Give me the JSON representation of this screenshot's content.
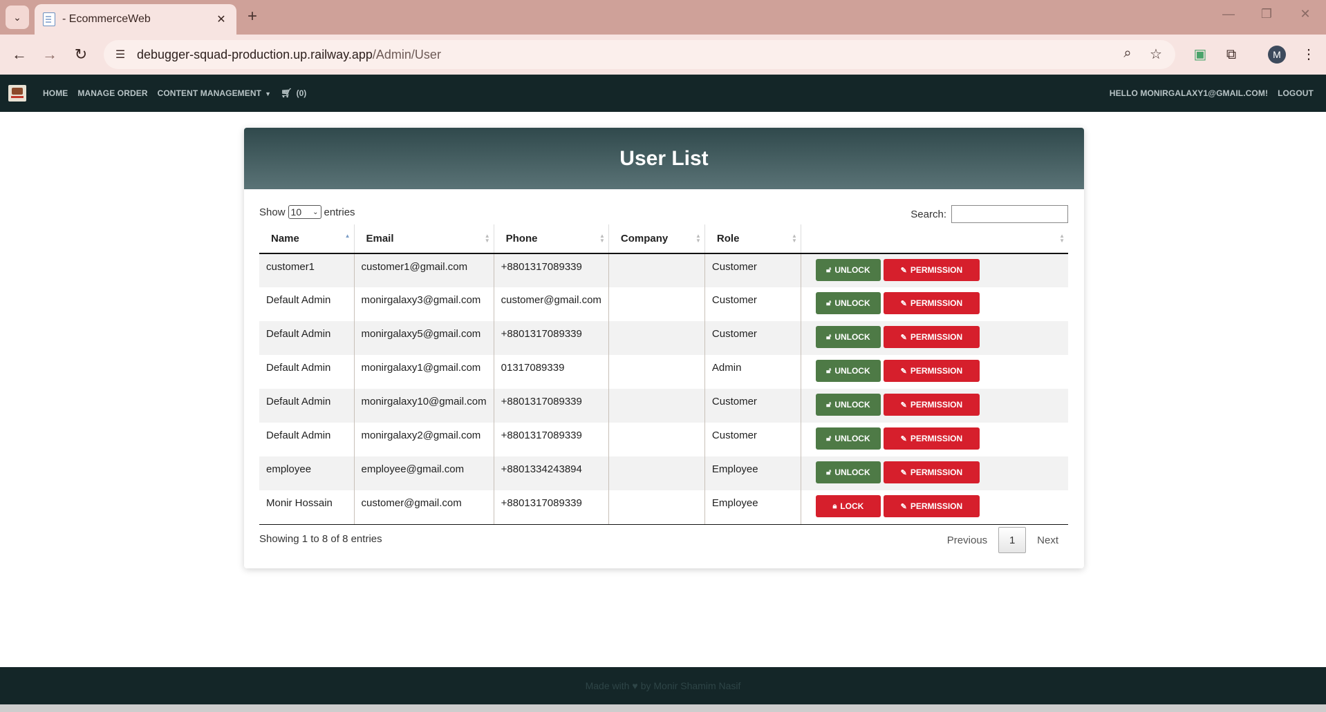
{
  "browser": {
    "tab_title": "- EcommerceWeb",
    "url_host": "debugger-squad-production.up.railway.app",
    "url_path": "/Admin/User",
    "profile_initial": "M"
  },
  "navbar": {
    "links": [
      "HOME",
      "MANAGE ORDER",
      "CONTENT MANAGEMENT"
    ],
    "cart_count": "(0)",
    "greeting": "HELLO MONIRGALAXY1@GMAIL.COM!",
    "logout": "LOGOUT"
  },
  "page": {
    "title": "User List",
    "show_label": "Show",
    "entries_value": "10",
    "entries_label": "entries",
    "search_label": "Search:",
    "search_value": "",
    "info": "Showing 1 to 8 of 8 entries",
    "pagination": {
      "previous": "Previous",
      "current": "1",
      "next": "Next"
    }
  },
  "table": {
    "columns": [
      "Name",
      "Email",
      "Phone",
      "Company",
      "Role",
      ""
    ],
    "rows": [
      {
        "name": "customer1",
        "email": "customer1@gmail.com",
        "phone": "+8801317089339",
        "company": "",
        "role": "Customer",
        "lock_label": "UNLOCK",
        "permission_label": "PERMISSION"
      },
      {
        "name": "Default Admin",
        "email": "monirgalaxy3@gmail.com",
        "phone": "customer@gmail.com",
        "company": "",
        "role": "Customer",
        "lock_label": "UNLOCK",
        "permission_label": "PERMISSION"
      },
      {
        "name": "Default Admin",
        "email": "monirgalaxy5@gmail.com",
        "phone": "+8801317089339",
        "company": "",
        "role": "Customer",
        "lock_label": "UNLOCK",
        "permission_label": "PERMISSION"
      },
      {
        "name": "Default Admin",
        "email": "monirgalaxy1@gmail.com",
        "phone": "01317089339",
        "company": "",
        "role": "Admin",
        "lock_label": "UNLOCK",
        "permission_label": "PERMISSION"
      },
      {
        "name": "Default Admin",
        "email": "monirgalaxy10@gmail.com",
        "phone": "+8801317089339",
        "company": "",
        "role": "Customer",
        "lock_label": "UNLOCK",
        "permission_label": "PERMISSION"
      },
      {
        "name": "Default Admin",
        "email": "monirgalaxy2@gmail.com",
        "phone": "+8801317089339",
        "company": "",
        "role": "Customer",
        "lock_label": "UNLOCK",
        "permission_label": "PERMISSION"
      },
      {
        "name": "employee",
        "email": "employee@gmail.com",
        "phone": "+8801334243894",
        "company": "",
        "role": "Employee",
        "lock_label": "UNLOCK",
        "permission_label": "PERMISSION"
      },
      {
        "name": "Monir Hossain",
        "email": "customer@gmail.com",
        "phone": "+8801317089339",
        "company": "",
        "role": "Employee",
        "lock_label": "LOCK",
        "permission_label": "PERMISSION"
      }
    ]
  },
  "footer": {
    "text_before": "Made with",
    "text_after": "by Monir Shamim Nasif"
  },
  "colors": {
    "navbar_bg": "#142628",
    "unlock_button": "#4e7a46",
    "lock_button": "#d61f2c",
    "permission_button": "#d61f2c"
  }
}
